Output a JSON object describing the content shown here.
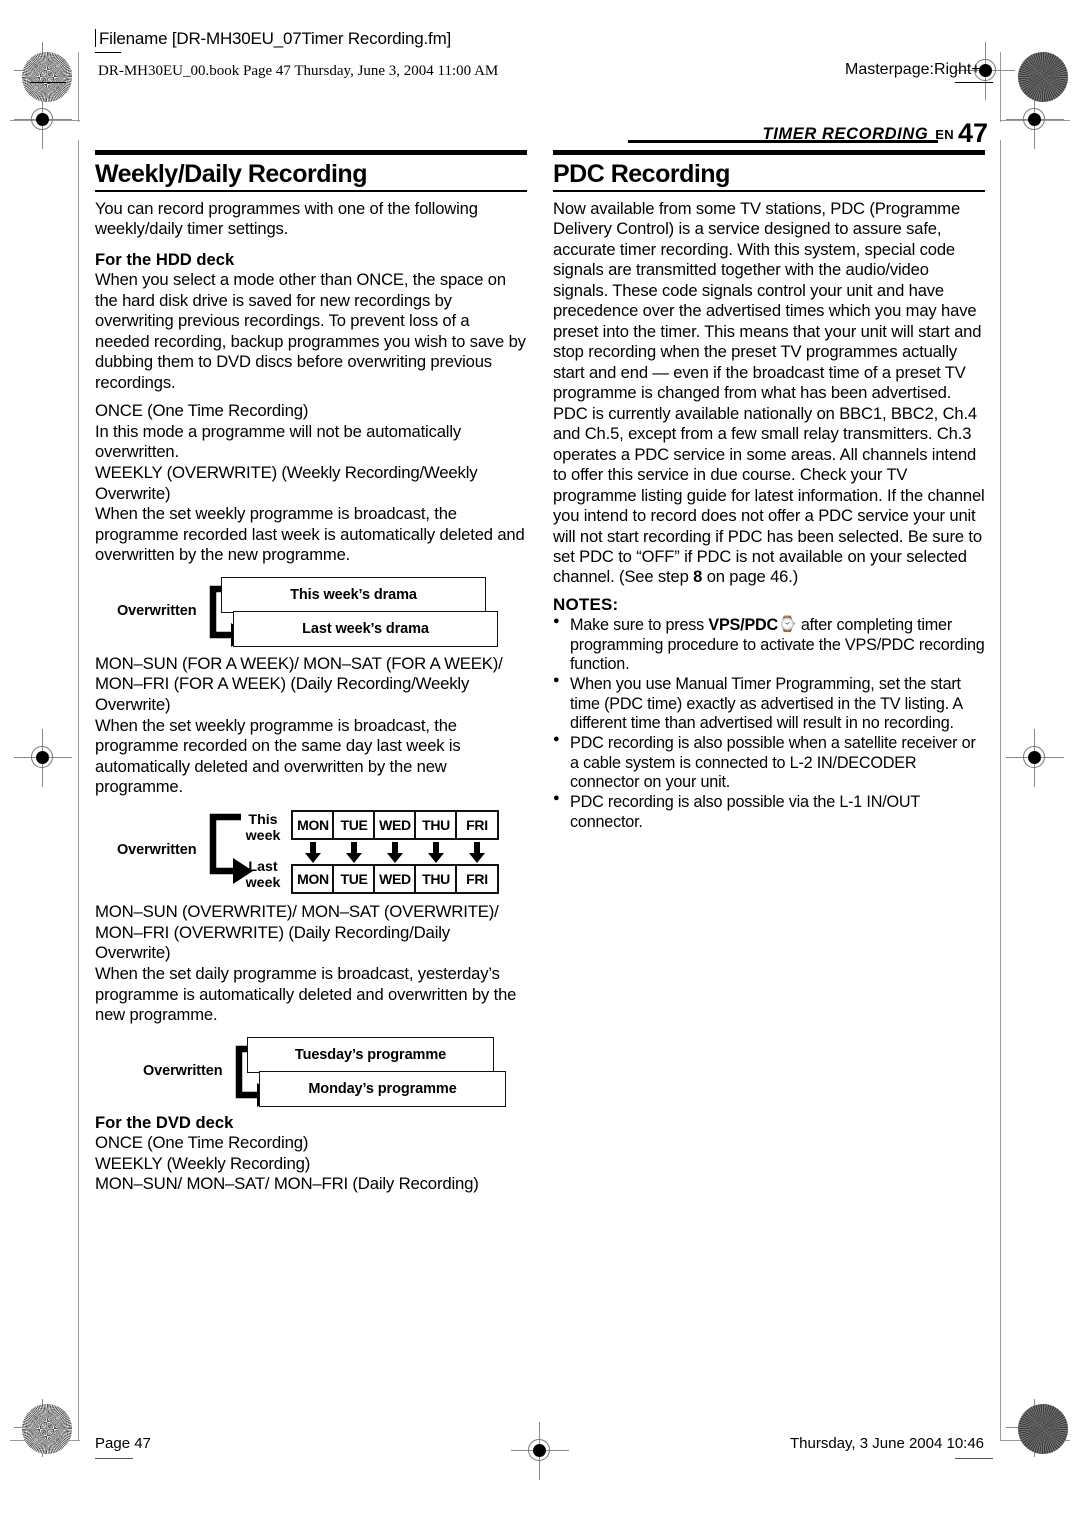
{
  "header": {
    "filename_label": "Filename [DR-MH30EU_07Timer Recording.fm]",
    "book_line": "DR-MH30EU_00.book  Page 47  Thursday, June 3, 2004  11:00 AM",
    "masterpage": "Masterpage:Right+"
  },
  "running_head": {
    "section": "TIMER RECORDING",
    "lang": "EN",
    "page_number": "47"
  },
  "left_column": {
    "title": "Weekly/Daily Recording",
    "intro": "You can record programmes with one of the following weekly/daily timer settings.",
    "hdd_subhead": "For the HDD deck",
    "hdd_body": "When you select a mode other than ONCE, the space on the hard disk drive is saved for new recordings by overwriting previous recordings. To prevent loss of a needed recording, backup programmes you wish to save by dubbing them to DVD discs before overwriting previous recordings.",
    "mode_once_label": "ONCE (One Time Recording)",
    "mode_once_body": "In this mode a programme will not be automatically overwritten.",
    "mode_weekly_label": "WEEKLY (OVERWRITE) (Weekly Recording/Weekly Overwrite)",
    "mode_weekly_body": "When the set weekly programme is broadcast, the programme recorded last week is automatically deleted and overwritten by the new programme.",
    "figure_weekly": {
      "overwritten_label": "Overwritten",
      "top_box": "This week’s drama",
      "bottom_box": "Last week’s drama"
    },
    "mode_week_label": "MON–SUN (FOR A WEEK)/ MON–SAT (FOR A WEEK)/ MON–FRI (FOR A WEEK) (Daily Recording/Weekly Overwrite)",
    "mode_week_body": "When the set weekly programme is broadcast, the programme recorded on the same day last week is automatically deleted and overwritten by the new programme.",
    "figure_days": {
      "overwritten_label": "Overwritten",
      "this_week_label_line1": "This",
      "this_week_label_line2": "week",
      "last_week_label_line1": "Last",
      "last_week_label_line2": "week",
      "days": [
        "MON",
        "TUE",
        "WED",
        "THU",
        "FRI"
      ]
    },
    "mode_daily_label": "MON–SUN (OVERWRITE)/ MON–SAT (OVERWRITE)/ MON–FRI (OVERWRITE) (Daily Recording/Daily Overwrite)",
    "mode_daily_body": "When the set daily programme is broadcast, yesterday’s programme is automatically deleted and overwritten by the new programme.",
    "figure_daily": {
      "overwritten_label": "Overwritten",
      "top_box": "Tuesday’s programme",
      "bottom_box": "Monday’s programme"
    },
    "dvd_subhead": "For the DVD deck",
    "dvd_mode_1": "ONCE (One Time Recording)",
    "dvd_mode_2": "WEEKLY (Weekly Recording)",
    "dvd_mode_3": "MON–SUN/ MON–SAT/ MON–FRI (Daily Recording)"
  },
  "right_column": {
    "title": "PDC Recording",
    "body_1": "Now available from some TV stations, PDC (Programme Delivery Control) is a service designed to assure safe, accurate timer recording. With this system, special code signals are transmitted together with the audio/video signals. These code signals control your unit and have precedence over the advertised times which you may have preset into the timer. This means that your unit will start and stop recording when the preset TV programmes actually start and end — even if the broadcast time of a preset TV programme is changed from what has been advertised. PDC is currently available nationally on BBC1, BBC2, Ch.4 and Ch.5, except from a few small relay transmitters. Ch.3 operates a PDC service in some areas. All channels intend to offer this service in due course. Check your TV programme listing guide for latest information. If the channel you intend to record does not offer a PDC service your unit will not start recording if PDC has been selected. Be sure to set PDC to “OFF” if PDC is not available on your selected channel. (See step ",
    "body_1_step": "8",
    "body_1_tail": " on page 46.)",
    "notes_title": "NOTES:",
    "note_1_pre": "Make sure to press ",
    "note_1_bold": "VPS/PDC",
    "note_1_glyph": "⌚",
    "note_1_post": " after completing timer programming procedure to activate the VPS/PDC recording function.",
    "note_2": "When you use Manual Timer Programming, set the start time (PDC time) exactly as advertised in the TV listing. A different time than advertised will result in no recording.",
    "note_3": "PDC recording is also possible when a satellite receiver or a cable system is connected to L-2 IN/DECODER connector on your unit.",
    "note_4": "PDC recording is also possible via the L-1 IN/OUT connector."
  },
  "footer": {
    "page_label": "Page 47",
    "timestamp": "Thursday, 3 June 2004  10:46"
  }
}
